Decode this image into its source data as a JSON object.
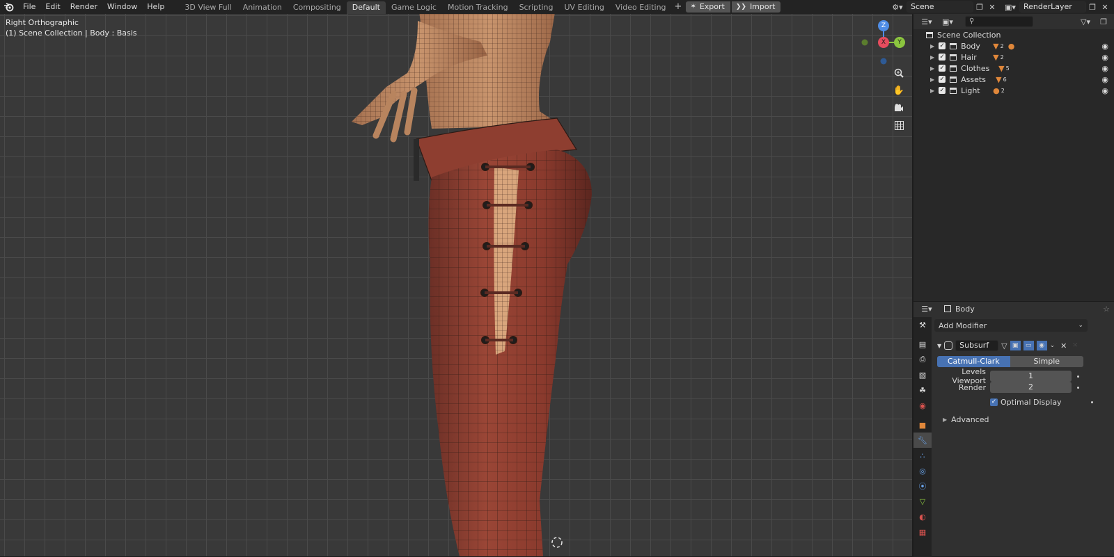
{
  "menu": {
    "file": "File",
    "edit": "Edit",
    "render": "Render",
    "window": "Window",
    "help": "Help"
  },
  "workspaces": [
    "3D View Full",
    "Animation",
    "Compositing",
    "Default",
    "Game Logic",
    "Motion Tracking",
    "Scripting",
    "UV Editing",
    "Video Editing"
  ],
  "active_workspace": "Default",
  "add_tab_label": "+",
  "toolbar": {
    "export_label": "Export",
    "import_label": "Import"
  },
  "scene": {
    "name": "Scene",
    "render_layer": "RenderLayer"
  },
  "viewport": {
    "view_name": "Right Orthographic",
    "context": "(1) Scene Collection | Body : Basis"
  },
  "gizmo": {
    "x": "X",
    "y": "Y",
    "z": "Z"
  },
  "outliner": {
    "root": "Scene Collection",
    "items": [
      {
        "label": "Body",
        "count": "2"
      },
      {
        "label": "Hair",
        "count": "2"
      },
      {
        "label": "Clothes",
        "count": "5"
      },
      {
        "label": "Assets",
        "count": "6"
      },
      {
        "label": "Light",
        "count": "2"
      }
    ]
  },
  "properties": {
    "object_name": "Body",
    "add_modifier": "Add Modifier",
    "modifier_name": "Subsurf",
    "subdiv_types": [
      "Catmull-Clark",
      "Simple"
    ],
    "active_subdiv_type": "Catmull-Clark",
    "levels_viewport_label": "Levels Viewport",
    "levels_viewport_value": "1",
    "render_label": "Render",
    "render_value": "2",
    "optimal_display_label": "Optimal Display",
    "optimal_display_checked": true,
    "advanced_label": "Advanced"
  },
  "colors": {
    "accent": "#4772b3",
    "orange": "#e0873a",
    "x_axis": "#e74c5e",
    "y_axis": "#8bc53f",
    "z_axis": "#4f8de6"
  }
}
